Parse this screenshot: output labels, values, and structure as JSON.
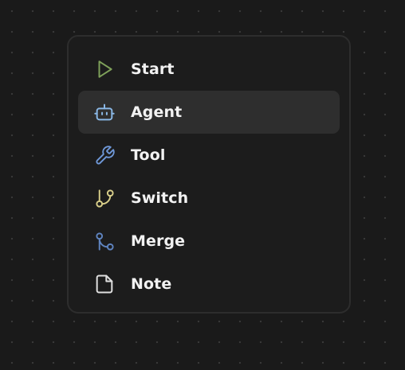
{
  "menu": {
    "items": [
      {
        "label": "Start",
        "icon": "play-icon",
        "color": "#7fa15a",
        "active": false
      },
      {
        "label": "Agent",
        "icon": "bot-icon",
        "color": "#8ab8e6",
        "active": true
      },
      {
        "label": "Tool",
        "icon": "wrench-icon",
        "color": "#6f98d8",
        "active": false
      },
      {
        "label": "Switch",
        "icon": "git-branch-icon",
        "color": "#d9cf8a",
        "active": false
      },
      {
        "label": "Merge",
        "icon": "git-merge-icon",
        "color": "#5f84c0",
        "active": false
      },
      {
        "label": "Note",
        "icon": "file-icon",
        "color": "#e0e0e0",
        "active": false
      }
    ]
  }
}
